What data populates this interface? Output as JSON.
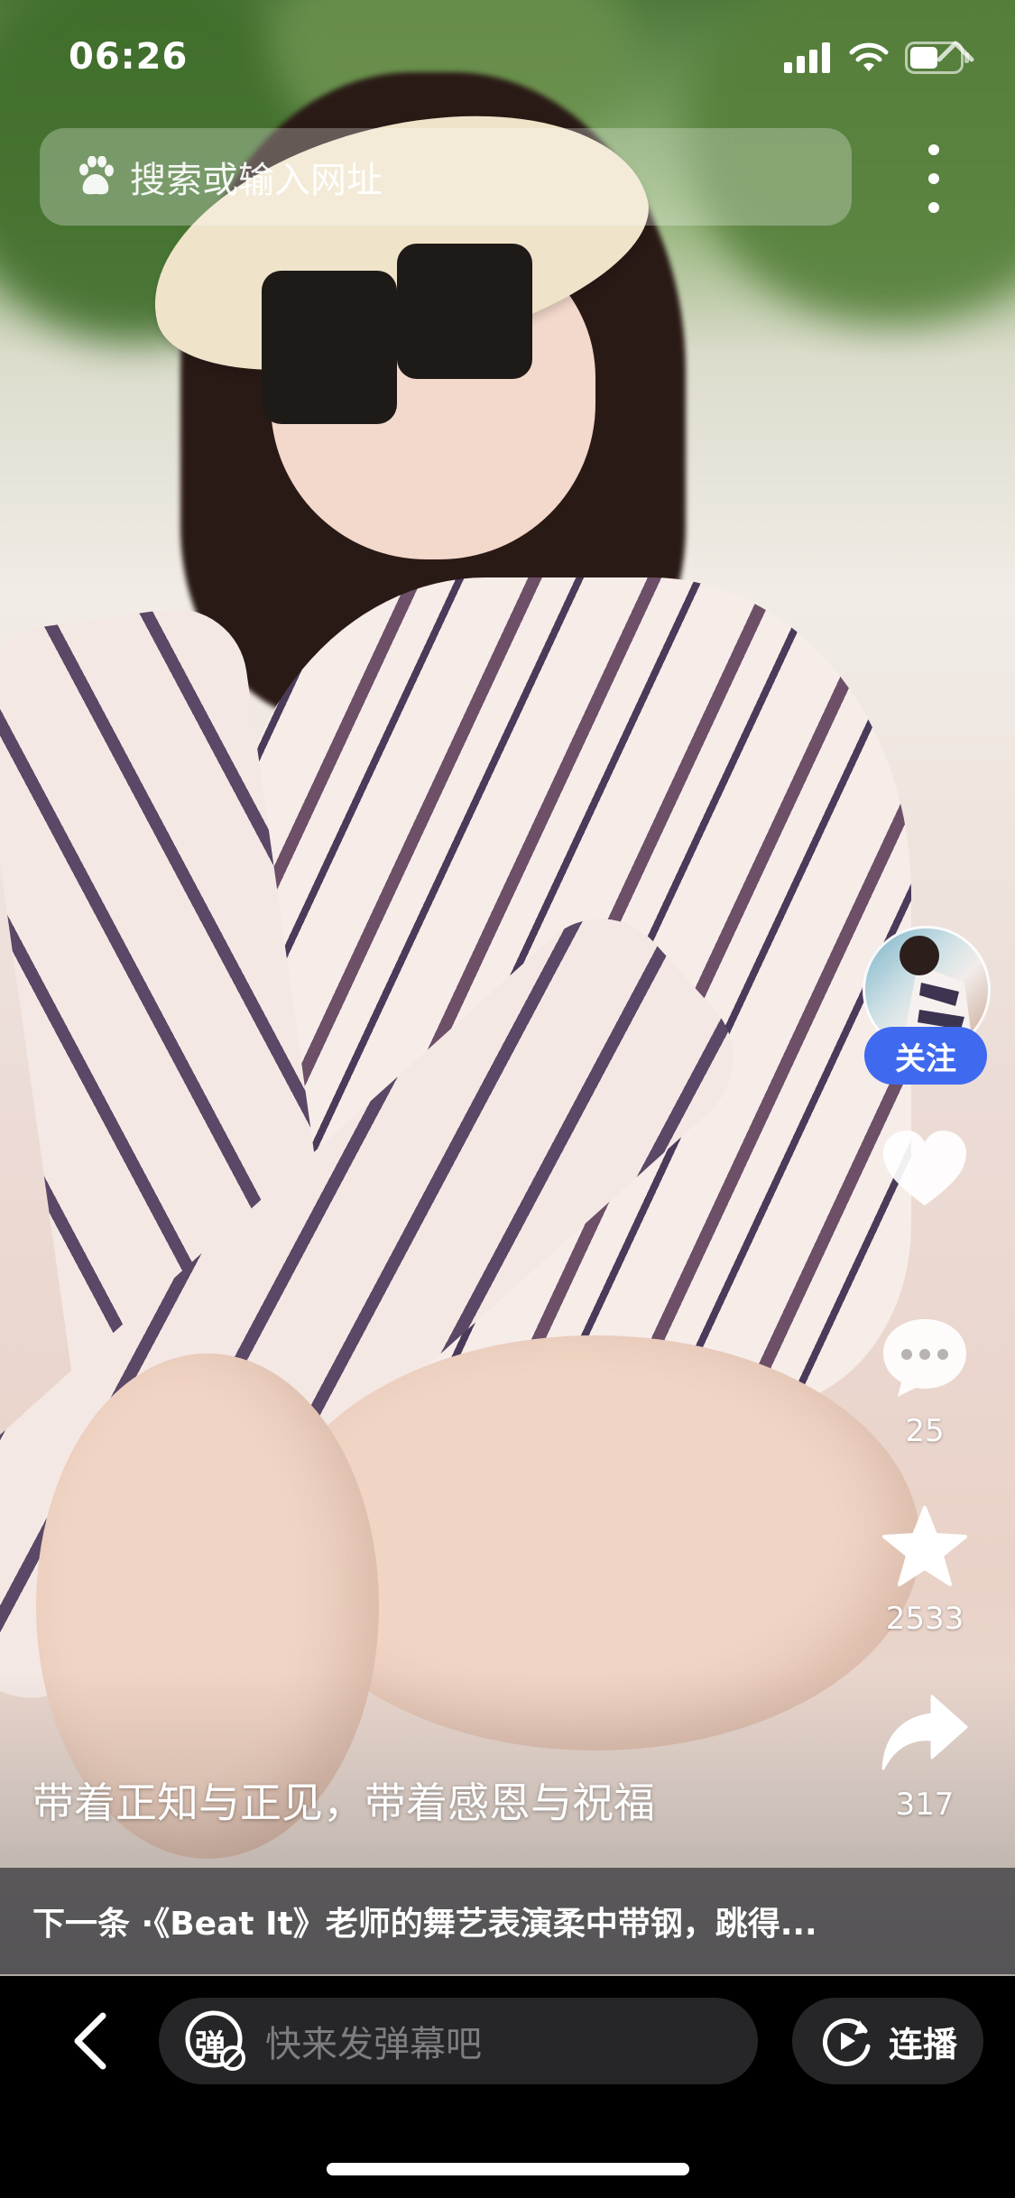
{
  "status_bar": {
    "time": "06:26",
    "icons": [
      "cellular-signal-icon",
      "wifi-icon",
      "battery-icon"
    ]
  },
  "search": {
    "placeholder": "搜索或输入网址",
    "logo_icon": "baidu-paw-icon",
    "more_icon": "more-vertical-icon"
  },
  "video": {
    "caption": "带着正知与正见，带着感恩与祝福"
  },
  "actions": {
    "follow_label": "关注",
    "like_count": "",
    "comment_count": "25",
    "favorite_count": "2533",
    "share_count": "317"
  },
  "next_up": {
    "text": "下一条 ·《Beat It》老师的舞艺表演柔中带钢，跳得..."
  },
  "bottom_bar": {
    "danmu_badge": "弹",
    "danmu_placeholder": "快来发弹幕吧",
    "autoplay_label": "连播"
  },
  "colors": {
    "follow_button": "#3f6af0",
    "bar_background": "#000000",
    "input_background": "#262628"
  }
}
